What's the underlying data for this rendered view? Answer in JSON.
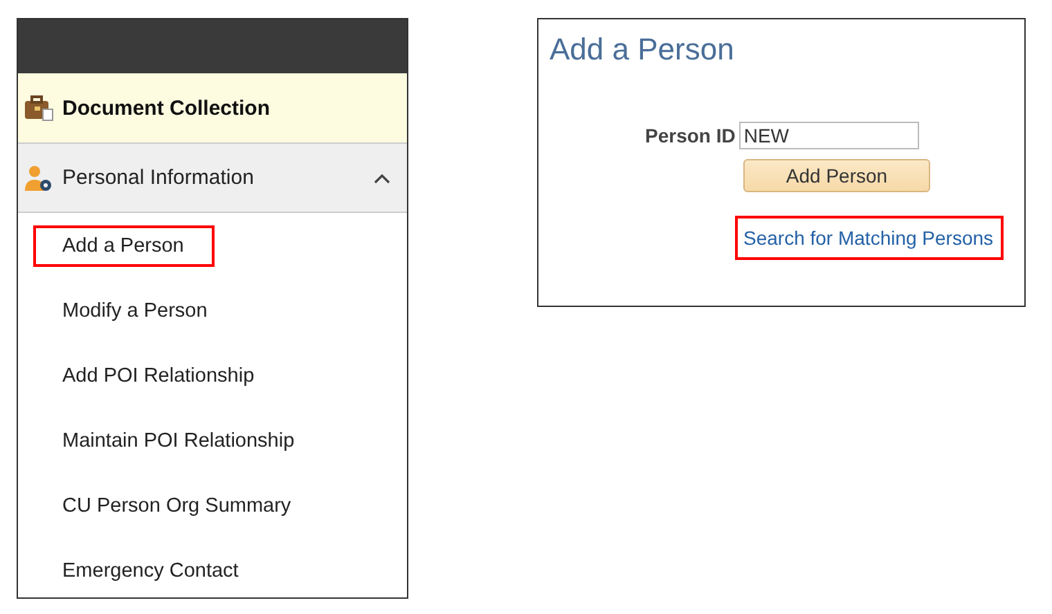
{
  "sidebar": {
    "header": {
      "label": "Document Collection"
    },
    "group": {
      "label": "Personal Information",
      "expanded": true
    },
    "items": [
      {
        "label": "Add a Person",
        "highlighted": true
      },
      {
        "label": "Modify a Person",
        "highlighted": false
      },
      {
        "label": "Add POI Relationship",
        "highlighted": false
      },
      {
        "label": "Maintain POI Relationship",
        "highlighted": false
      },
      {
        "label": "CU Person Org Summary",
        "highlighted": false
      },
      {
        "label": "Emergency Contact",
        "highlighted": false
      }
    ]
  },
  "panel": {
    "title": "Add a Person",
    "field": {
      "label": "Person ID",
      "value": "NEW"
    },
    "button": "Add Person",
    "link": {
      "label": "Search for Matching Persons",
      "highlighted": true
    }
  }
}
